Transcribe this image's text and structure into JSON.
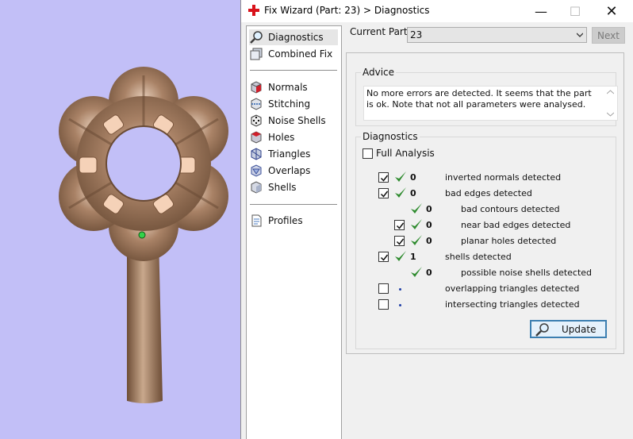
{
  "window": {
    "title": "Fix Wizard (Part: 23) > Diagnostics",
    "controls": {
      "minimize": "—",
      "maximize": "☐",
      "close": "✕"
    }
  },
  "nav": {
    "items": [
      {
        "label": "Diagnostics",
        "icon": "magnifier-icon",
        "selected": true
      },
      {
        "label": "Combined Fix",
        "icon": "stacked-shells-icon"
      },
      {
        "label": "Normals",
        "icon": "red-cube-icon"
      },
      {
        "label": "Stitching",
        "icon": "stitching-icon"
      },
      {
        "label": "Noise Shells",
        "icon": "dice-icon"
      },
      {
        "label": "Holes",
        "icon": "holes-cube-icon"
      },
      {
        "label": "Triangles",
        "icon": "triangles-icon"
      },
      {
        "label": "Overlaps",
        "icon": "overlaps-icon"
      },
      {
        "label": "Shells",
        "icon": "shells-icon"
      },
      {
        "label": "Profiles",
        "icon": "document-icon"
      }
    ]
  },
  "part": {
    "label": "Current Part:",
    "value": "23",
    "next_label": "Next"
  },
  "advice": {
    "title": "Advice",
    "text": "No more errors are detected. It seems that the part is ok. Note that not all parameters were analysed."
  },
  "diagnostics": {
    "title": "Diagnostics",
    "full_analysis_label": "Full Analysis",
    "full_analysis_checked": false,
    "rows": [
      {
        "checked": true,
        "status": "ok",
        "count": "0",
        "label": "inverted normals detected",
        "indent": 0
      },
      {
        "checked": true,
        "status": "ok",
        "count": "0",
        "label": "bad edges detected",
        "indent": 0
      },
      {
        "checked": null,
        "status": "ok",
        "count": "0",
        "label": "bad contours detected",
        "indent": 1
      },
      {
        "checked": true,
        "status": "ok",
        "count": "0",
        "label": "near bad edges detected",
        "indent": 1
      },
      {
        "checked": true,
        "status": "ok",
        "count": "0",
        "label": "planar holes detected",
        "indent": 1
      },
      {
        "checked": true,
        "status": "ok",
        "count": "1",
        "label": "shells detected",
        "indent": 0
      },
      {
        "checked": null,
        "status": "ok",
        "count": "0",
        "label": "possible noise shells detected",
        "indent": 1
      },
      {
        "checked": false,
        "status": "pending",
        "count": "",
        "label": "overlapping triangles detected",
        "indent": 0
      },
      {
        "checked": false,
        "status": "pending",
        "count": "",
        "label": "intersecting triangles detected",
        "indent": 0
      }
    ],
    "update_label": "Update"
  },
  "colors": {
    "viewport_bg": "#c2bff7",
    "part_bronze": "#8e6a4f",
    "ok_tick": "#2e8b2e",
    "accent_border": "#3c7fb1"
  }
}
